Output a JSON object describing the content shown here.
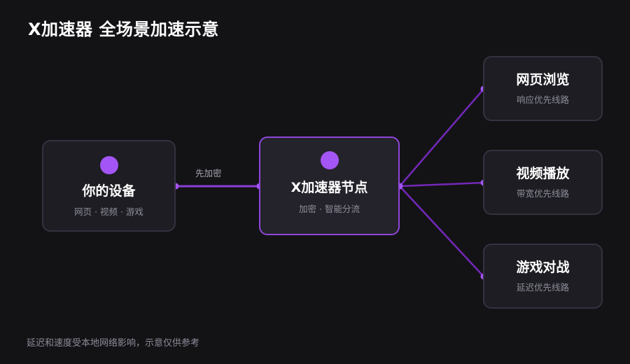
{
  "title": "X加速器 全场景加速示意",
  "footnote": "延迟和速度受本地网络影响，示意仅供参考",
  "colors": {
    "background": "#131316",
    "accent": "#a455f5",
    "link_line": "#7428b8",
    "card_border": "#34323f",
    "hub_border": "#8f46d8"
  },
  "nodes": {
    "device": {
      "title": "你的设备",
      "subtitle": "网页 · 视频 · 游戏"
    },
    "hub": {
      "title": "X加速器节点",
      "subtitle": "加密 · 智能分流"
    },
    "web": {
      "title": "网页浏览",
      "subtitle": "响应优先线路"
    },
    "video": {
      "title": "视频播放",
      "subtitle": "带宽优先线路"
    },
    "game": {
      "title": "游戏对战",
      "subtitle": "延迟优先线路"
    }
  },
  "edges": {
    "device_to_hub": {
      "label": "先加密"
    }
  }
}
